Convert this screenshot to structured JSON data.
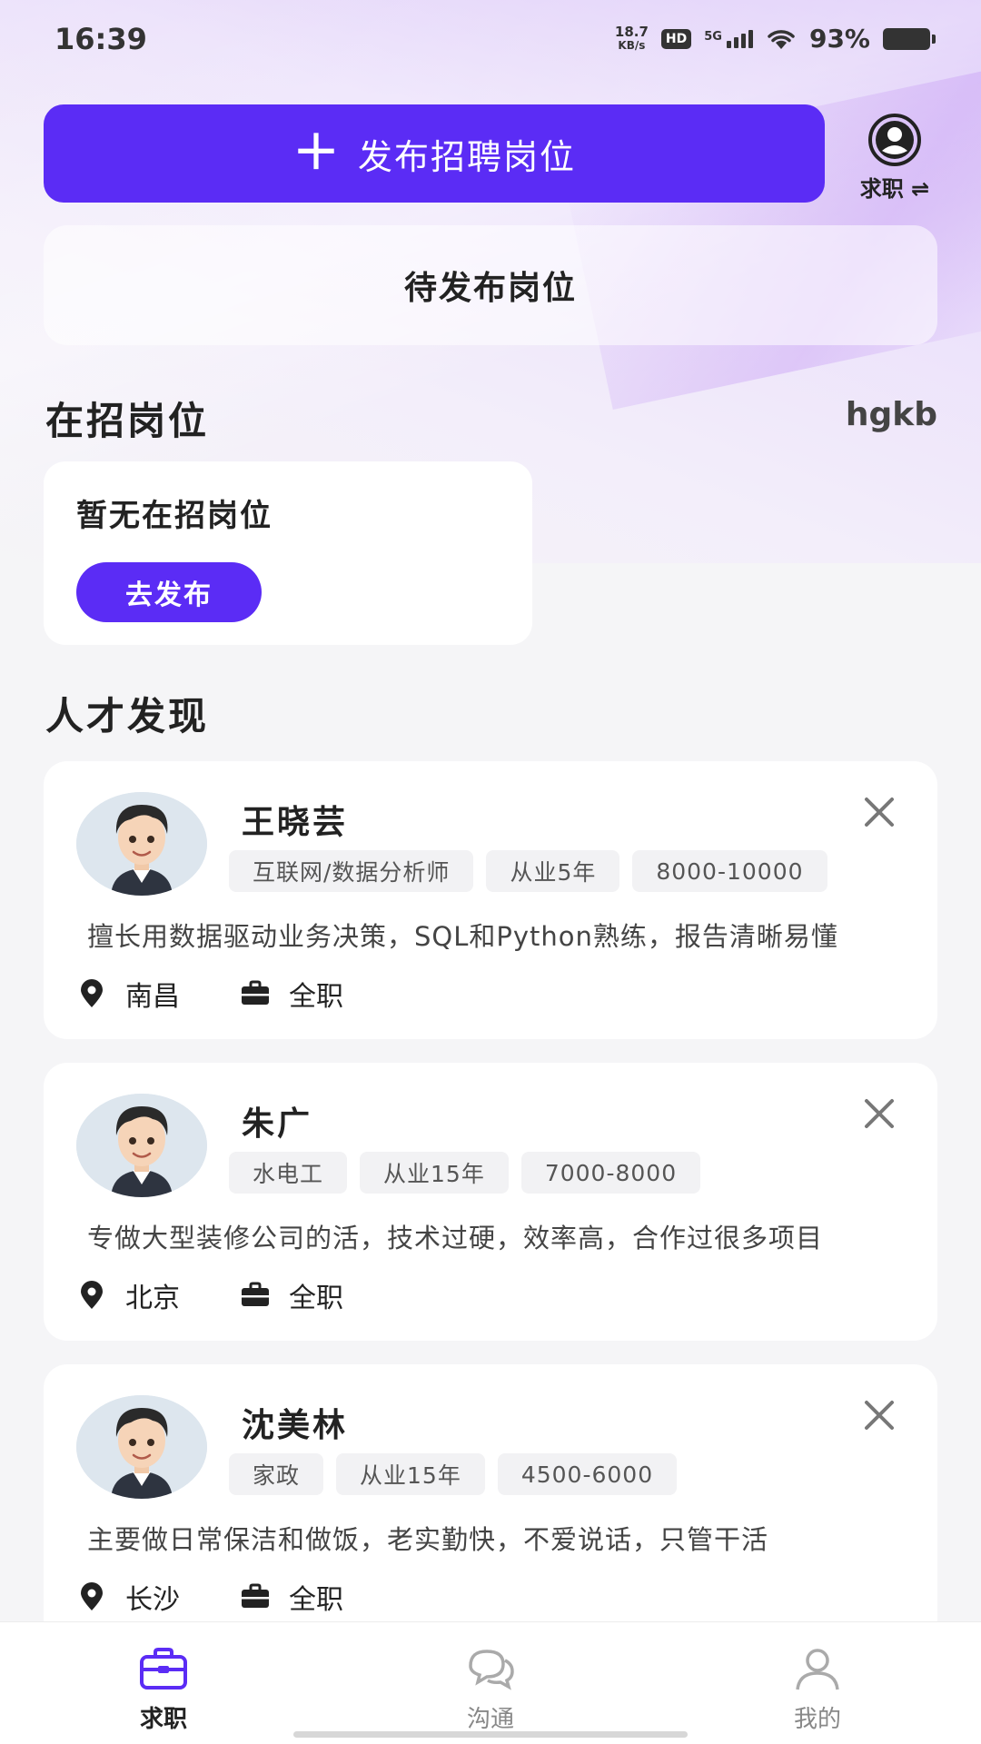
{
  "status_bar": {
    "time": "16:39",
    "net_speed_value": "18.7",
    "net_speed_unit": "KB/s",
    "hd": "HD",
    "network": "5G",
    "battery": "93%"
  },
  "header": {
    "publish_button": "发布招聘岗位",
    "role_switch_label": "求职 ⇌",
    "pending_label": "待发布岗位"
  },
  "active_section": {
    "title": "在招岗位",
    "user": "hgkb",
    "empty_text": "暂无在招岗位",
    "go_publish": "去发布"
  },
  "talent_section": {
    "title": "人才发现",
    "cards": [
      {
        "name": "王晓芸",
        "tags": [
          "互联网/数据分析师",
          "从业5年",
          "8000-10000"
        ],
        "description": "擅长用数据驱动业务决策，SQL和Python熟练，报告清晰易懂",
        "city": "南昌",
        "job_type": "全职"
      },
      {
        "name": "朱广",
        "tags": [
          "水电工",
          "从业15年",
          "7000-8000"
        ],
        "description": "专做大型装修公司的活，技术过硬，效率高，合作过很多项目",
        "city": "北京",
        "job_type": "全职"
      },
      {
        "name": "沈美林",
        "tags": [
          "家政",
          "从业15年",
          "4500-6000"
        ],
        "description": "主要做日常保洁和做饭，老实勤快，不爱说话，只管干活",
        "city": "长沙",
        "job_type": "全职"
      }
    ]
  },
  "bottom_nav": {
    "items": [
      {
        "label": "求职",
        "icon": "briefcase-icon"
      },
      {
        "label": "沟通",
        "icon": "chat-icon"
      },
      {
        "label": "我的",
        "icon": "person-icon"
      }
    ]
  },
  "colors": {
    "accent": "#5b2cf5",
    "background": "#f5f5f7"
  }
}
